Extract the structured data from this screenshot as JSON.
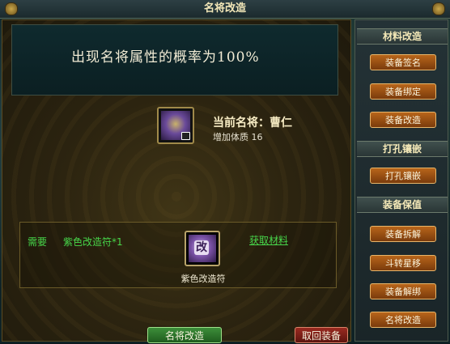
{
  "window": {
    "title": "名将改造"
  },
  "banner": {
    "probability_text": "出现名将属性的概率为100%"
  },
  "general": {
    "name_line": "当前名将：曹仁",
    "attribute_line": "增加体质 16"
  },
  "requirement": {
    "label": "需要",
    "item": "紫色改造符*1",
    "material_name": "紫色改造符",
    "material_glyph": "改",
    "get_link": "获取材料"
  },
  "buttons": {
    "confirm": "名将改造",
    "retrieve": "取回装备"
  },
  "sidebar": {
    "sections": [
      {
        "header": "材料改造",
        "items": [
          "装备签名",
          "装备绑定",
          "装备改造"
        ]
      },
      {
        "header": "打孔镶嵌",
        "items": [
          "打孔镶嵌"
        ]
      },
      {
        "header": "装备保值",
        "items": [
          "装备拆解",
          "斗转星移",
          "装备解绑",
          "名将改造"
        ]
      }
    ]
  }
}
